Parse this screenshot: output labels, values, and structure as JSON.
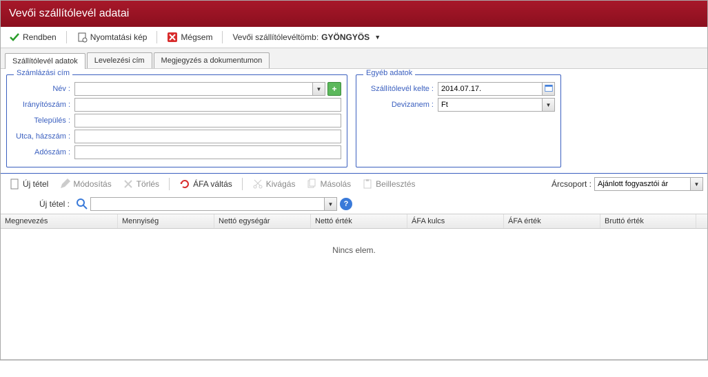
{
  "title": "Vevői szállítólevél adatai",
  "main_toolbar": {
    "ok_label": "Rendben",
    "print_label": "Nyomtatási kép",
    "cancel_label": "Mégsem",
    "block_label": "Vevői szállítólevéltömb:",
    "block_value": "GYÖNGYÖS"
  },
  "tabs": {
    "t1": "Szállítólevél adatok",
    "t2": "Levelezési cím",
    "t3": "Megjegyzés a dokumentumon"
  },
  "billing": {
    "legend": "Számlázási cím",
    "name_label": "Név :",
    "name_value": "",
    "zip_label": "Irányítószám :",
    "zip_value": "",
    "city_label": "Település :",
    "city_value": "",
    "street_label": "Utca, házszám :",
    "street_value": "",
    "tax_label": "Adószám :",
    "tax_value": ""
  },
  "other": {
    "legend": "Egyéb adatok",
    "date_label": "Szállítólevél kelte :",
    "date_value": "2014.07.17.",
    "currency_label": "Devizanem :",
    "currency_value": "Ft"
  },
  "item_toolbar": {
    "new": "Új tétel",
    "modify": "Módosítás",
    "delete": "Törlés",
    "vat": "ÁFA váltás",
    "cut": "Kivágás",
    "copy": "Másolás",
    "paste": "Beillesztés"
  },
  "pricegroup": {
    "label": "Árcsoport :",
    "value": "Ajánlott fogyasztói ár"
  },
  "new_item": {
    "label": "Új tétel :",
    "value": ""
  },
  "grid": {
    "headers": {
      "name": "Megnevezés",
      "qty": "Mennyiség",
      "unit_net": "Nettó egységár",
      "net": "Nettó érték",
      "vat_rate": "ÁFA kulcs",
      "vat_val": "ÁFA érték",
      "gross": "Bruttó érték"
    },
    "empty": "Nincs elem."
  }
}
